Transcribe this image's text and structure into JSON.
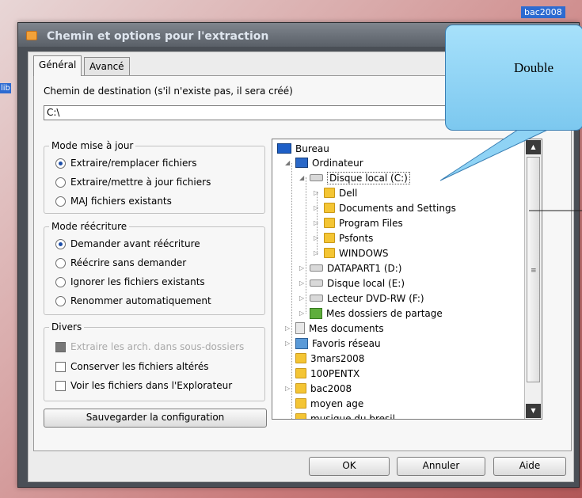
{
  "desktop": {
    "top_label": "bac2008",
    "left_label": "lib"
  },
  "window": {
    "title": "Chemin et options pour l'extraction"
  },
  "tabs": [
    {
      "label": "Général",
      "active": true
    },
    {
      "label": "Avancé",
      "active": false
    }
  ],
  "destination": {
    "label": "Chemin de destination (s'il n'existe pas, il sera créé)",
    "value": "C:\\"
  },
  "update_mode": {
    "legend": "Mode mise à jour",
    "options": [
      {
        "label": "Extraire/remplacer fichiers",
        "selected": true
      },
      {
        "label": "Extraire/mettre à jour fichiers",
        "selected": false
      },
      {
        "label": "MAJ fichiers existants",
        "selected": false
      }
    ]
  },
  "overwrite_mode": {
    "legend": "Mode réécriture",
    "options": [
      {
        "label": "Demander avant réécriture",
        "selected": true
      },
      {
        "label": "Réécrire sans demander",
        "selected": false
      },
      {
        "label": "Ignorer les fichiers existants",
        "selected": false
      },
      {
        "label": "Renommer automatiquement",
        "selected": false
      }
    ]
  },
  "misc": {
    "legend": "Divers",
    "options": [
      {
        "label": "Extraire les arch. dans sous-dossiers",
        "checked": false,
        "disabled": true
      },
      {
        "label": "Conserver les fichiers altérés",
        "checked": false,
        "disabled": false
      },
      {
        "label": "Voir les fichiers dans l'Explorateur",
        "checked": false,
        "disabled": false
      }
    ]
  },
  "save_button": "Sauvegarder la configuration",
  "tree": [
    {
      "label": "Bureau",
      "icon": "desktop-icon"
    },
    {
      "label": "Ordinateur",
      "icon": "computer-icon"
    },
    {
      "label": "Disque local (C:)",
      "icon": "drive-icon",
      "selected": true
    },
    {
      "label": "Dell",
      "icon": "folder-icon"
    },
    {
      "label": "Documents and Settings",
      "icon": "folder-icon"
    },
    {
      "label": "Program Files",
      "icon": "folder-icon"
    },
    {
      "label": "Psfonts",
      "icon": "folder-icon"
    },
    {
      "label": "WINDOWS",
      "icon": "folder-icon"
    },
    {
      "label": "DATAPART1 (D:)",
      "icon": "drive-icon"
    },
    {
      "label": "Disque local (E:)",
      "icon": "drive-icon"
    },
    {
      "label": "Lecteur DVD-RW (F:)",
      "icon": "dvd-drive-icon"
    },
    {
      "label": "Mes dossiers de partage",
      "icon": "shared-folder-icon"
    },
    {
      "label": "Mes documents",
      "icon": "documents-icon"
    },
    {
      "label": "Favoris réseau",
      "icon": "network-icon"
    },
    {
      "label": "3mars2008",
      "icon": "folder-icon"
    },
    {
      "label": "100PENTX",
      "icon": "folder-icon"
    },
    {
      "label": "bac2008",
      "icon": "folder-icon"
    },
    {
      "label": "moyen age",
      "icon": "folder-icon"
    },
    {
      "label": "musique du bresil",
      "icon": "folder-icon"
    }
  ],
  "buttons": {
    "ok": "OK",
    "cancel": "Annuler",
    "help": "Aide"
  },
  "callout": {
    "text": "Double"
  },
  "colors": {
    "window_frame": "#4a4f56",
    "callout": "#8fd3f5",
    "selection": "#1d4ea8"
  }
}
